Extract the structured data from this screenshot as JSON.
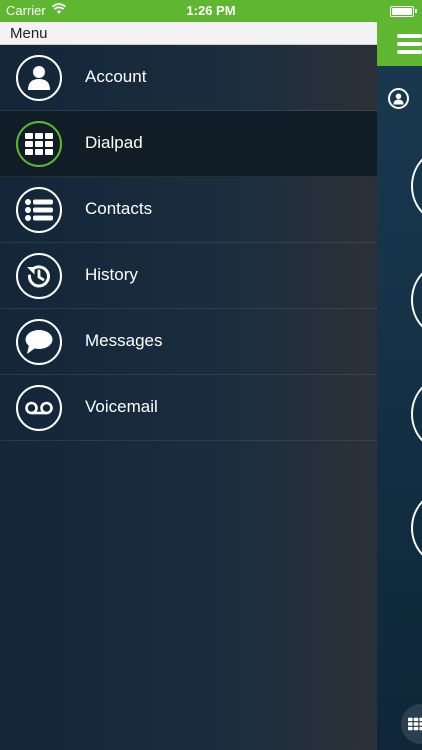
{
  "status_bar": {
    "carrier": "Carrier",
    "time": "1:26 PM"
  },
  "menu": {
    "title": "Menu",
    "items": [
      {
        "label": "Account",
        "icon": "person-icon",
        "active": false
      },
      {
        "label": "Dialpad",
        "icon": "dialpad-grid-icon",
        "active": true
      },
      {
        "label": "Contacts",
        "icon": "list-icon",
        "active": false
      },
      {
        "label": "History",
        "icon": "history-icon",
        "active": false
      },
      {
        "label": "Messages",
        "icon": "speech-bubble-icon",
        "active": false
      },
      {
        "label": "Voicemail",
        "icon": "voicemail-icon",
        "active": false
      }
    ]
  },
  "colors": {
    "accent_green": "#5fb731",
    "menu_background": "#13263a",
    "active_row": "#101c26",
    "header_background": "#f4f4f4"
  }
}
